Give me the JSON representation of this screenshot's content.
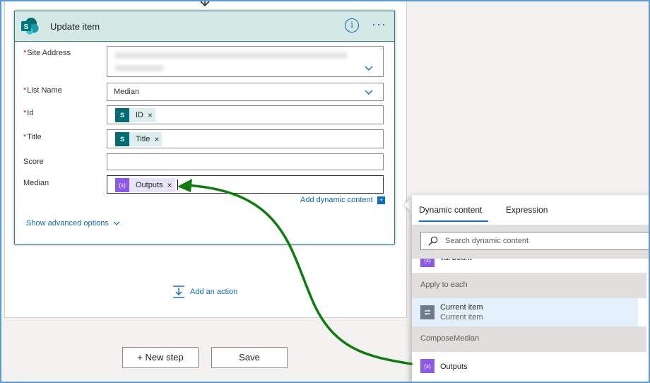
{
  "card": {
    "title": "Update item",
    "fields": {
      "site_address": {
        "label": "Site Address",
        "required": "*"
      },
      "list_name": {
        "label": "List Name",
        "required": "*",
        "value": "Median"
      },
      "id": {
        "label": "Id",
        "required": "*",
        "token": "ID"
      },
      "title": {
        "label": "Title",
        "required": "*",
        "token": "Title"
      },
      "score": {
        "label": "Score",
        "value": ""
      },
      "median": {
        "label": "Median",
        "token": "Outputs"
      }
    },
    "add_dynamic_label": "Add dynamic content",
    "show_advanced_label": "Show advanced options",
    "token_remove": "×"
  },
  "canvas": {
    "add_action_label": "Add an action",
    "new_step_label": "+ New step",
    "save_label": "Save"
  },
  "dynamic_panel": {
    "tabs": [
      "Dynamic content",
      "Expression"
    ],
    "active_tab": "Dynamic content",
    "search_placeholder": "Search dynamic content",
    "partial_item": "varCount",
    "sections": [
      {
        "name": "Apply to each",
        "items": [
          {
            "title": "Current item",
            "subtitle": "Current item"
          }
        ]
      },
      {
        "name": "ComposeMedian",
        "items": [
          {
            "title": "Outputs"
          }
        ]
      }
    ]
  },
  "colors": {
    "accent": "#0f6cbd",
    "sharepoint": "#036c70",
    "variable": "#8c5ae6",
    "arrow": "#107c10",
    "header": "#d4e8e6"
  },
  "icons": {
    "sharepoint": "sharepoint-logo-icon",
    "variable": "variable-icon",
    "loop": "loop-icon",
    "search": "search-icon",
    "info": "info-icon",
    "more": "more-icon"
  }
}
